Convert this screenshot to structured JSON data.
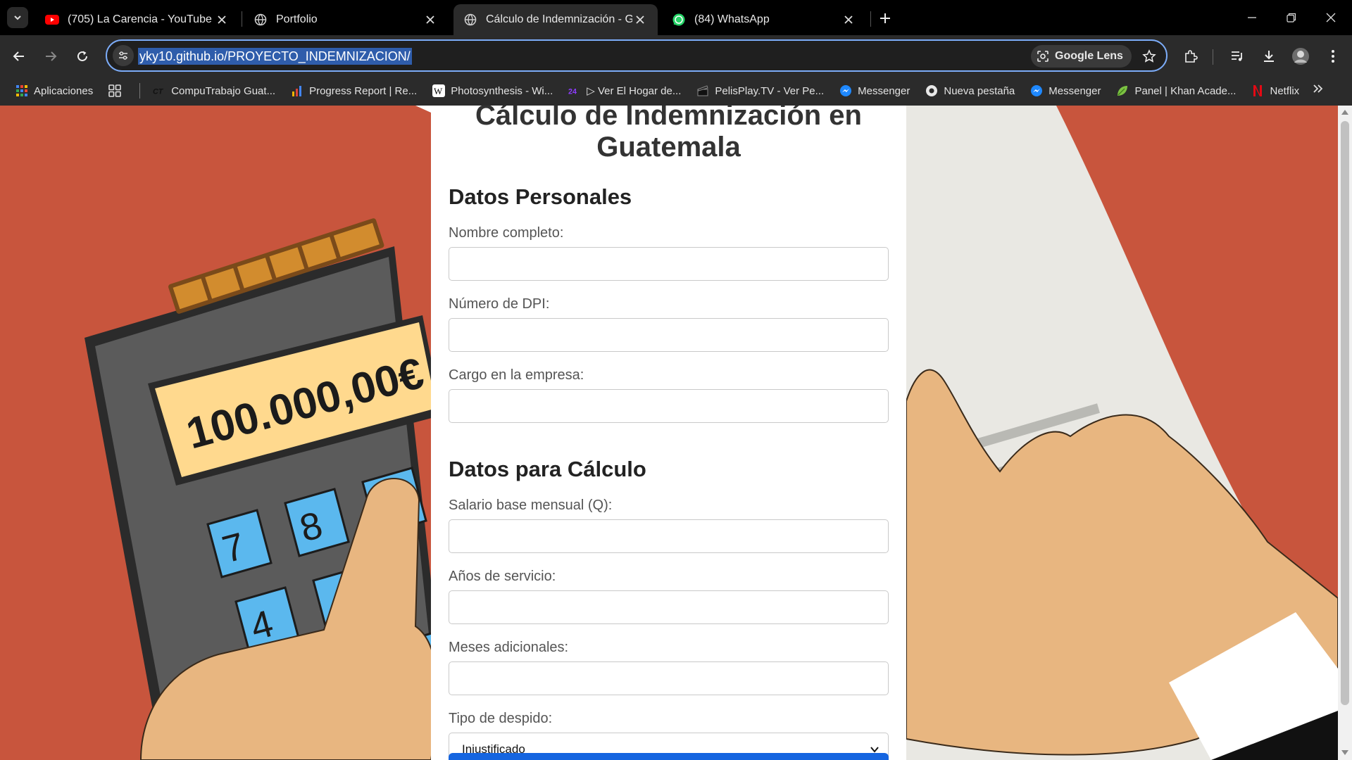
{
  "browser": {
    "tabs": [
      {
        "title": "(705) La Carencia - YouTube",
        "favicon": "youtube-icon",
        "active": false
      },
      {
        "title": "Portfolio",
        "favicon": "globe-icon",
        "active": false
      },
      {
        "title": "Cálculo de Indemnización - Gua",
        "favicon": "globe-icon",
        "active": true
      },
      {
        "title": "(84) WhatsApp",
        "favicon": "whatsapp-icon",
        "active": false
      }
    ],
    "url": "yky10.github.io/PROYECTO_INDEMNIZACION/",
    "lens_label": "Google Lens",
    "bookmarks": [
      {
        "label": "Aplicaciones",
        "icon": "apps-grid-icon"
      },
      {
        "label": "CompuTrabajo Guat...",
        "icon": "computrabajo-icon"
      },
      {
        "label": "Progress Report | Re...",
        "icon": "bar-chart-icon"
      },
      {
        "label": "Photosynthesis - Wi...",
        "icon": "wikipedia-icon"
      },
      {
        "label": "▷ Ver El Hogar de...",
        "icon": "tv24-icon"
      },
      {
        "label": "PelisPlay.TV - Ver Pe...",
        "icon": "clapper-icon"
      },
      {
        "label": "Messenger",
        "icon": "messenger-icon"
      },
      {
        "label": "Nueva pestaña",
        "icon": "chrome-icon"
      },
      {
        "label": "Messenger",
        "icon": "messenger-icon"
      },
      {
        "label": "Panel | Khan Acade...",
        "icon": "khan-leaf-icon"
      },
      {
        "label": "Netflix",
        "icon": "netflix-icon"
      }
    ]
  },
  "page": {
    "title": "Cálculo de Indemnización en Guatemala",
    "section_personal": "Datos Personales",
    "label_nombre": "Nombre completo:",
    "label_dpi": "Número de DPI:",
    "label_cargo": "Cargo en la empresa:",
    "section_calculo": "Datos para Cálculo",
    "label_salario": "Salario base mensual (Q):",
    "label_anios": "Años de servicio:",
    "label_meses": "Meses adicionales:",
    "label_tipo": "Tipo de despido:",
    "tipo_value": "Injustificado",
    "calculator_display": "100.000,00€"
  },
  "colors": {
    "background_orange": "#c8553d",
    "accent_blue": "#1565e0",
    "calculator_key": "#5bb8ee"
  }
}
